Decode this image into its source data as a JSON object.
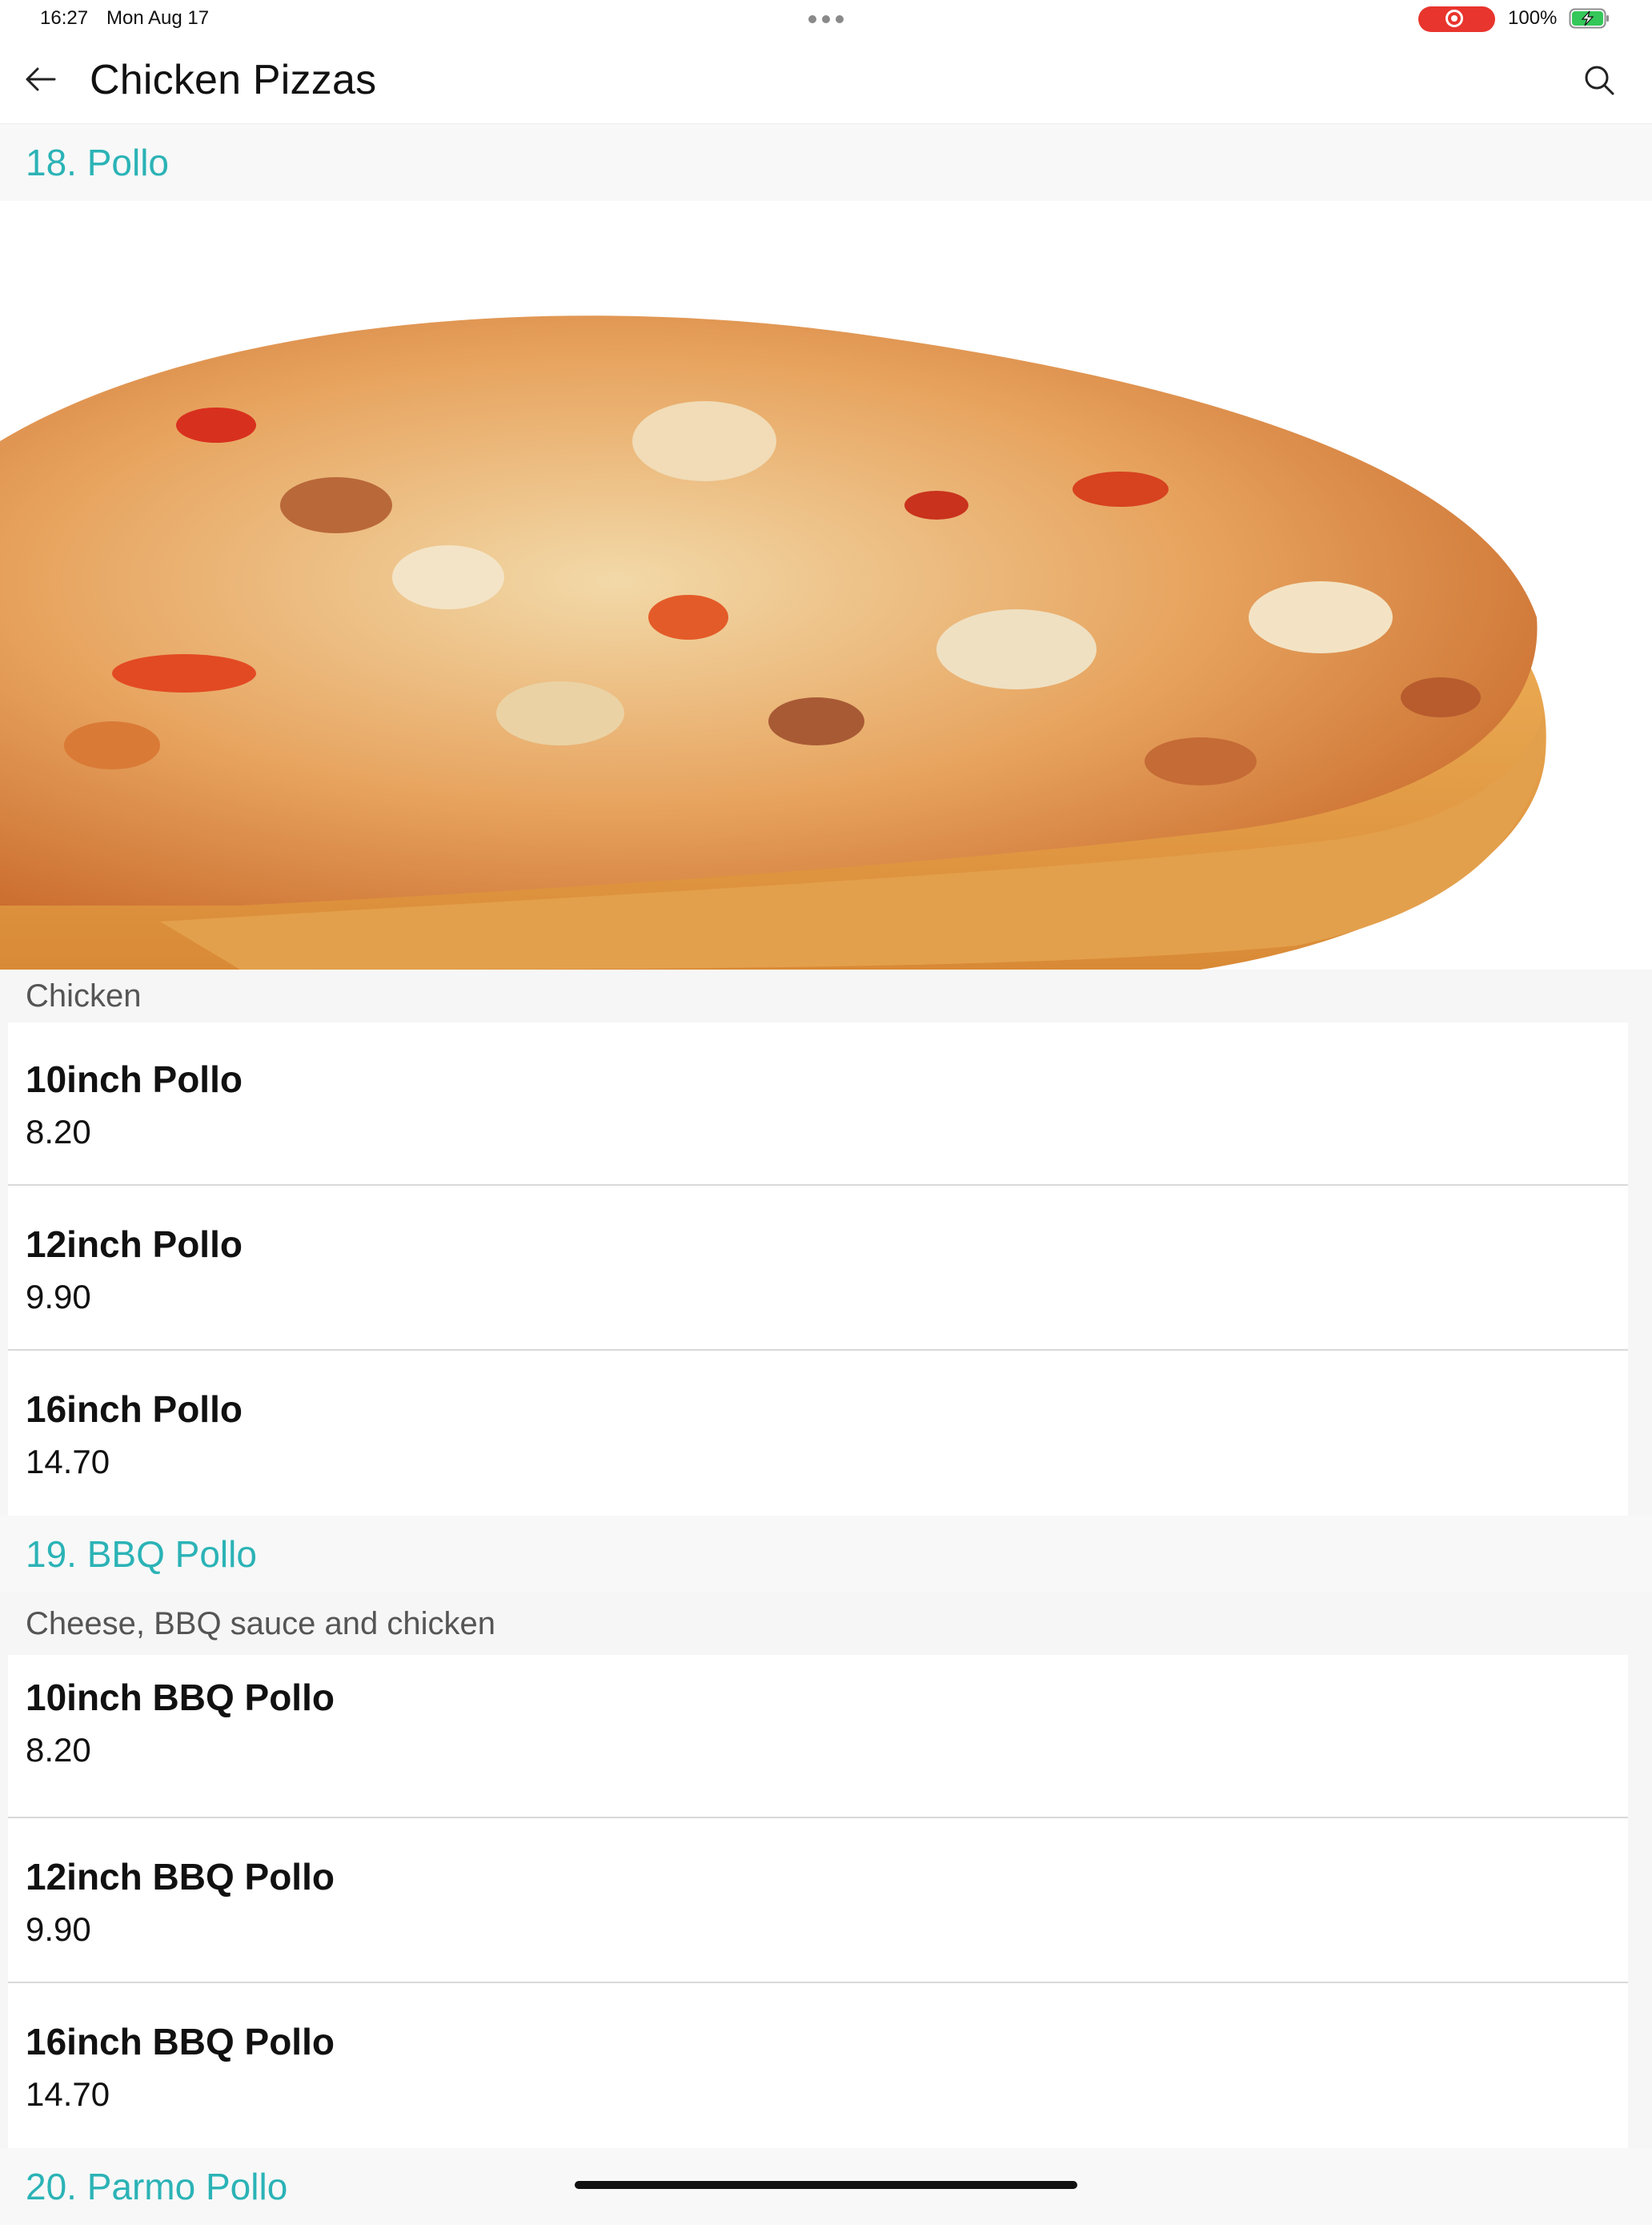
{
  "status_bar": {
    "time": "16:27",
    "date": "Mon Aug 17",
    "battery_percent": "100%",
    "recording_color": "#e8352d",
    "battery_color": "#34c759"
  },
  "header": {
    "title": "Chicken Pizzas",
    "back_icon": "arrow-left-icon",
    "search_icon": "search-icon"
  },
  "theme": {
    "accent": "#2bb3b6"
  },
  "sections": [
    {
      "heading": "18. Pollo",
      "has_image": true,
      "description": "Chicken",
      "items": [
        {
          "name": "10inch Pollo",
          "price": "8.20"
        },
        {
          "name": "12inch Pollo",
          "price": "9.90"
        },
        {
          "name": "16inch Pollo",
          "price": "14.70"
        }
      ]
    },
    {
      "heading": "19. BBQ Pollo",
      "has_image": false,
      "description": "Cheese, BBQ sauce and chicken",
      "items": [
        {
          "name": "10inch BBQ Pollo",
          "price": "8.20"
        },
        {
          "name": "12inch BBQ Pollo",
          "price": "9.90"
        },
        {
          "name": "16inch BBQ Pollo",
          "price": "14.70"
        }
      ]
    },
    {
      "heading": "20. Parmo Pollo"
    }
  ]
}
